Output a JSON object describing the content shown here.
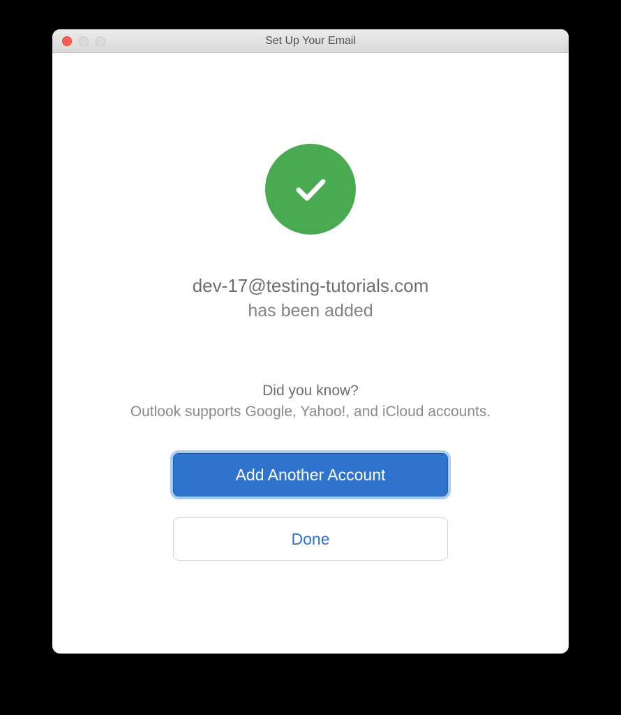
{
  "window": {
    "title": "Set Up Your Email"
  },
  "success": {
    "email": "dev-17@testing-tutorials.com",
    "message": "has been added"
  },
  "tip": {
    "heading": "Did you know?",
    "text": "Outlook supports Google, Yahoo!, and iCloud accounts."
  },
  "buttons": {
    "add_another": "Add Another Account",
    "done": "Done"
  },
  "colors": {
    "success_green": "#4aaa52",
    "primary_blue": "#2e73cd"
  }
}
